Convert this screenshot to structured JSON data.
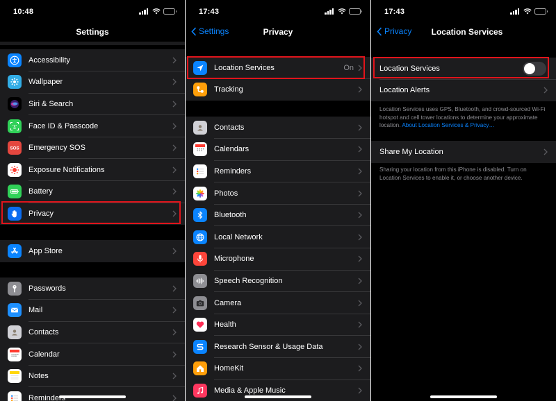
{
  "panel1": {
    "status": {
      "time": "10:48"
    },
    "title": "Settings",
    "groups": [
      [
        {
          "label": "Accessibility",
          "icon": "accessibility-icon",
          "color": "#0a84ff"
        },
        {
          "label": "Wallpaper",
          "icon": "wallpaper-icon",
          "color": "#32ade6"
        },
        {
          "label": "Siri & Search",
          "icon": "siri-icon",
          "color": "#1c1c1e"
        },
        {
          "label": "Face ID & Passcode",
          "icon": "face-id-icon",
          "color": "#30d158"
        },
        {
          "label": "Emergency SOS",
          "icon": "sos-icon",
          "color": "#e5473f"
        },
        {
          "label": "Exposure Notifications",
          "icon": "exposure-icon",
          "color": "#ffffff"
        },
        {
          "label": "Battery",
          "icon": "battery-icon",
          "color": "#30d158"
        },
        {
          "label": "Privacy",
          "icon": "hand-icon",
          "color": "#0a6cf0"
        }
      ],
      [
        {
          "label": "App Store",
          "icon": "app-store-icon",
          "color": "#0a84ff"
        }
      ],
      [
        {
          "label": "Passwords",
          "icon": "key-icon",
          "color": "#8e8e93"
        },
        {
          "label": "Mail",
          "icon": "mail-icon",
          "color": "#0a84ff"
        },
        {
          "label": "Contacts",
          "icon": "contacts-icon",
          "color": "#c7c7cc"
        },
        {
          "label": "Calendar",
          "icon": "calendar-icon",
          "color": "#ffffff"
        },
        {
          "label": "Notes",
          "icon": "notes-icon",
          "color": "#ffd60a"
        },
        {
          "label": "Reminders",
          "icon": "reminders-icon",
          "color": "#ffffff"
        }
      ]
    ]
  },
  "panel2": {
    "status": {
      "time": "17:43"
    },
    "back": "Settings",
    "title": "Privacy",
    "groups": [
      [
        {
          "label": "Location Services",
          "icon": "location-arrow-icon",
          "color": "#0a84ff",
          "value": "On"
        },
        {
          "label": "Tracking",
          "icon": "tracking-icon",
          "color": "#ff9f0a"
        }
      ],
      [
        {
          "label": "Contacts",
          "icon": "contacts-icon",
          "color": "#c7c7cc"
        },
        {
          "label": "Calendars",
          "icon": "calendar-icon",
          "color": "#ffffff"
        },
        {
          "label": "Reminders",
          "icon": "reminders-icon",
          "color": "#ffffff"
        },
        {
          "label": "Photos",
          "icon": "photos-icon",
          "color": "#ffffff"
        },
        {
          "label": "Bluetooth",
          "icon": "bluetooth-icon",
          "color": "#0a84ff"
        },
        {
          "label": "Local Network",
          "icon": "globe-icon",
          "color": "#0a84ff"
        },
        {
          "label": "Microphone",
          "icon": "microphone-icon",
          "color": "#ff453a"
        },
        {
          "label": "Speech Recognition",
          "icon": "waveform-icon",
          "color": "#8e8e93"
        },
        {
          "label": "Camera",
          "icon": "camera-icon",
          "color": "#8e8e93"
        },
        {
          "label": "Health",
          "icon": "heart-icon",
          "color": "#ffffff"
        },
        {
          "label": "Research Sensor & Usage Data",
          "icon": "research-icon",
          "color": "#0a84ff"
        },
        {
          "label": "HomeKit",
          "icon": "home-icon",
          "color": "#ff9f0a"
        },
        {
          "label": "Media & Apple Music",
          "icon": "music-icon",
          "color": "#ff375f"
        }
      ]
    ]
  },
  "panel3": {
    "status": {
      "time": "17:43"
    },
    "back": "Privacy",
    "title": "Location Services",
    "rows": {
      "location_services": "Location Services",
      "location_alerts": "Location Alerts",
      "share_my_location": "Share My Location"
    },
    "toggle_on": false,
    "footer1": "Location Services uses GPS, Bluetooth, and crowd-sourced Wi-Fi hotspot and cell tower locations to determine your approximate location.",
    "footer1_link": "About Location Services & Privacy…",
    "footer2": "Sharing your location from this iPhone is disabled. Turn on Location Services to enable it, or choose another device."
  },
  "colors": {
    "highlight": "#e1141b",
    "accent": "#0a84ff",
    "cell": "#1c1c1e",
    "background": "#000000"
  }
}
